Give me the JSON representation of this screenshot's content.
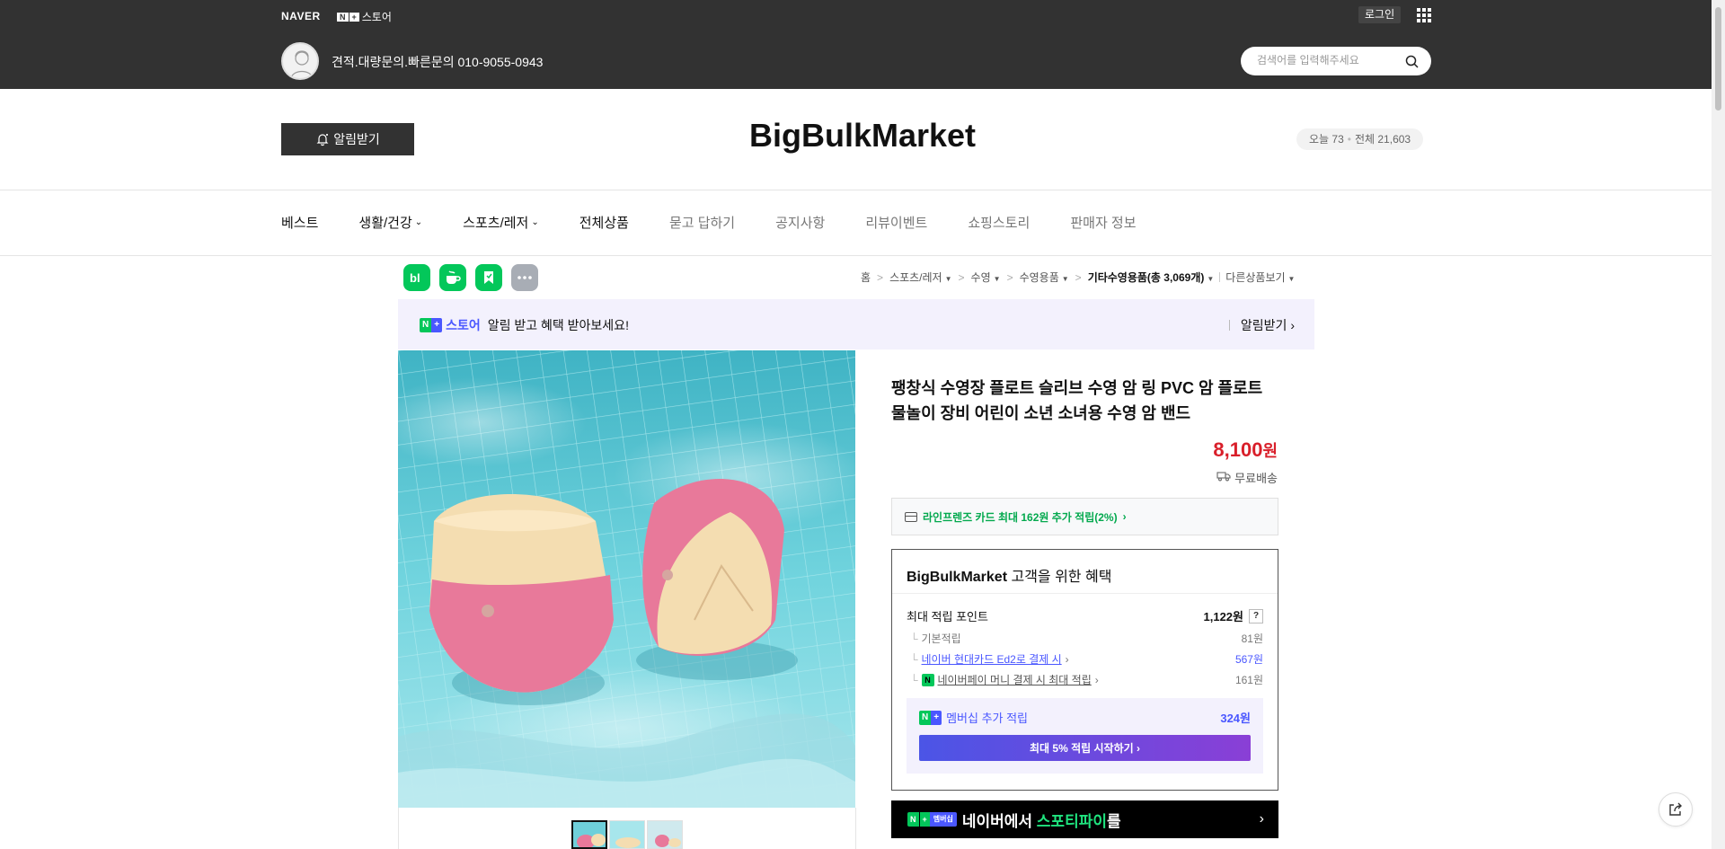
{
  "topbar": {
    "naver_logo": "NAVER",
    "store_badge_text": "스토어",
    "login": "로그인",
    "store_desc": "견적.대량문의.빠른문의 010-9055-0943",
    "search_placeholder": "검색어를 입력해주세요"
  },
  "header": {
    "notice_button": "알림받기",
    "store_name": "BigBulkMarket",
    "visit_today": "오늘 73",
    "visit_total": "전체 21,603"
  },
  "nav": {
    "items": [
      {
        "label": "베스트"
      },
      {
        "label": "생활/건강"
      },
      {
        "label": "스포츠/레저"
      },
      {
        "label": "전체상품"
      },
      {
        "label": "묻고 답하기"
      },
      {
        "label": "공지사항"
      },
      {
        "label": "리뷰이벤트"
      },
      {
        "label": "쇼핑스토리"
      },
      {
        "label": "판매자 정보"
      }
    ]
  },
  "share": {
    "icons": [
      "blog-icon",
      "cafe-icon",
      "bookmark-icon",
      "more-icon"
    ]
  },
  "breadcrumb": {
    "home": "홈",
    "c1": "스포츠/레저",
    "c2": "수영",
    "c3": "수영용품",
    "c4": "기타수영용품(총 3,069개)",
    "other": "다른상품보기"
  },
  "alarm": {
    "store": "스토어",
    "text": "알림 받고 혜택 받아보세요!",
    "button": "알림받기"
  },
  "product": {
    "title": "팽창식 수영장 플로트 슬리브 수영 암 링 PVC 암 플로트 물놀이 장비 어린이 소년 소녀용 수영 암 밴드",
    "price": "8,100",
    "price_unit": "원",
    "shipping": "무료배송",
    "card_benefit": "라인프렌즈 카드 최대 162원 추가 적립(2%)"
  },
  "benefits": {
    "title_store": "BigBulkMarket",
    "title_rest": "고객을 위한 혜택",
    "max_label": "최대 적립 포인트",
    "max_value": "1,122원",
    "q": "?",
    "rows": [
      {
        "label": "기본적립",
        "value": "81원"
      },
      {
        "label": "네이버 현대카드 Ed2로 결제 시",
        "value": "567원"
      },
      {
        "label": "네이버페이 머니 결제 시 최대 적립",
        "value": "161원"
      }
    ],
    "member_label": "멤버십 추가 적립",
    "member_value": "324원",
    "member_button": "최대 5% 적립 시작하기"
  },
  "sports_banner": {
    "badge": "멤버십",
    "text_pre": "네이버에서",
    "text_hl": "스포티파이",
    "text_post": "를"
  },
  "colors": {
    "topbar": "#323232",
    "naver_green": "#03c75a",
    "plus_blue": "#4a57ff",
    "price_red": "#d91f2a"
  }
}
